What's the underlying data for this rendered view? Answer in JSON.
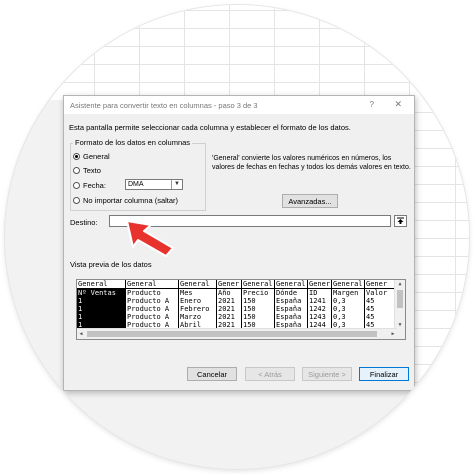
{
  "dialog": {
    "title": "Asistente para convertir texto en columnas - paso 3 de 3",
    "help_glyph": "?",
    "close_glyph": "✕",
    "description": "Esta pantalla permite seleccionar cada columna y establecer el formato de los datos."
  },
  "format_group": {
    "label": "Formato de los datos en columnas",
    "options": [
      {
        "label": "General",
        "checked": true
      },
      {
        "label": "Texto",
        "checked": false
      },
      {
        "label": "Fecha:",
        "checked": false
      },
      {
        "label": "No importar columna (saltar)",
        "checked": false
      }
    ],
    "date_format": {
      "selected": "DMA"
    }
  },
  "info_text": "'General' convierte los valores numéricos en números, los valores de fechas en fechas y todos los demás valores en texto.",
  "advanced_button": "Avanzadas...",
  "destination": {
    "label": "Destino:",
    "value": ""
  },
  "preview": {
    "label": "Vista previa de los datos",
    "columns": [
      {
        "header": "General",
        "cells": [
          "Nº Ventas",
          "1",
          "1",
          "1",
          "1"
        ],
        "selected": true
      },
      {
        "header": "General",
        "cells": [
          "Producto",
          "Producto A",
          "Producto A",
          "Producto A",
          "Producto A"
        ]
      },
      {
        "header": "General",
        "cells": [
          "Mes",
          "Enero",
          "Febrero",
          "Marzo",
          "Abril"
        ]
      },
      {
        "header": "Gener",
        "cells": [
          "Año",
          "2021",
          "2021",
          "2021",
          "2021"
        ]
      },
      {
        "header": "General",
        "cells": [
          "Precio",
          "150",
          "150",
          "150",
          "150"
        ]
      },
      {
        "header": "General",
        "cells": [
          "Dónde",
          "España",
          "España",
          "España",
          "España"
        ]
      },
      {
        "header": "Gener",
        "cells": [
          "ID",
          "1241",
          "1242",
          "1243",
          "1244"
        ]
      },
      {
        "header": "General",
        "cells": [
          "Margen",
          "0,3",
          "0,3",
          "0,3",
          "0,3"
        ]
      },
      {
        "header": "Gener",
        "cells": [
          "Valor",
          "45",
          "45",
          "45",
          "45"
        ]
      }
    ]
  },
  "footer": {
    "cancel": "Cancelar",
    "back": "< Atrás",
    "next": "Siguiente >",
    "finish": "Finalizar"
  },
  "colors": {
    "arrow": "#e8322e",
    "arrow_outline": "#ffffff",
    "accent": "#0078d7"
  }
}
